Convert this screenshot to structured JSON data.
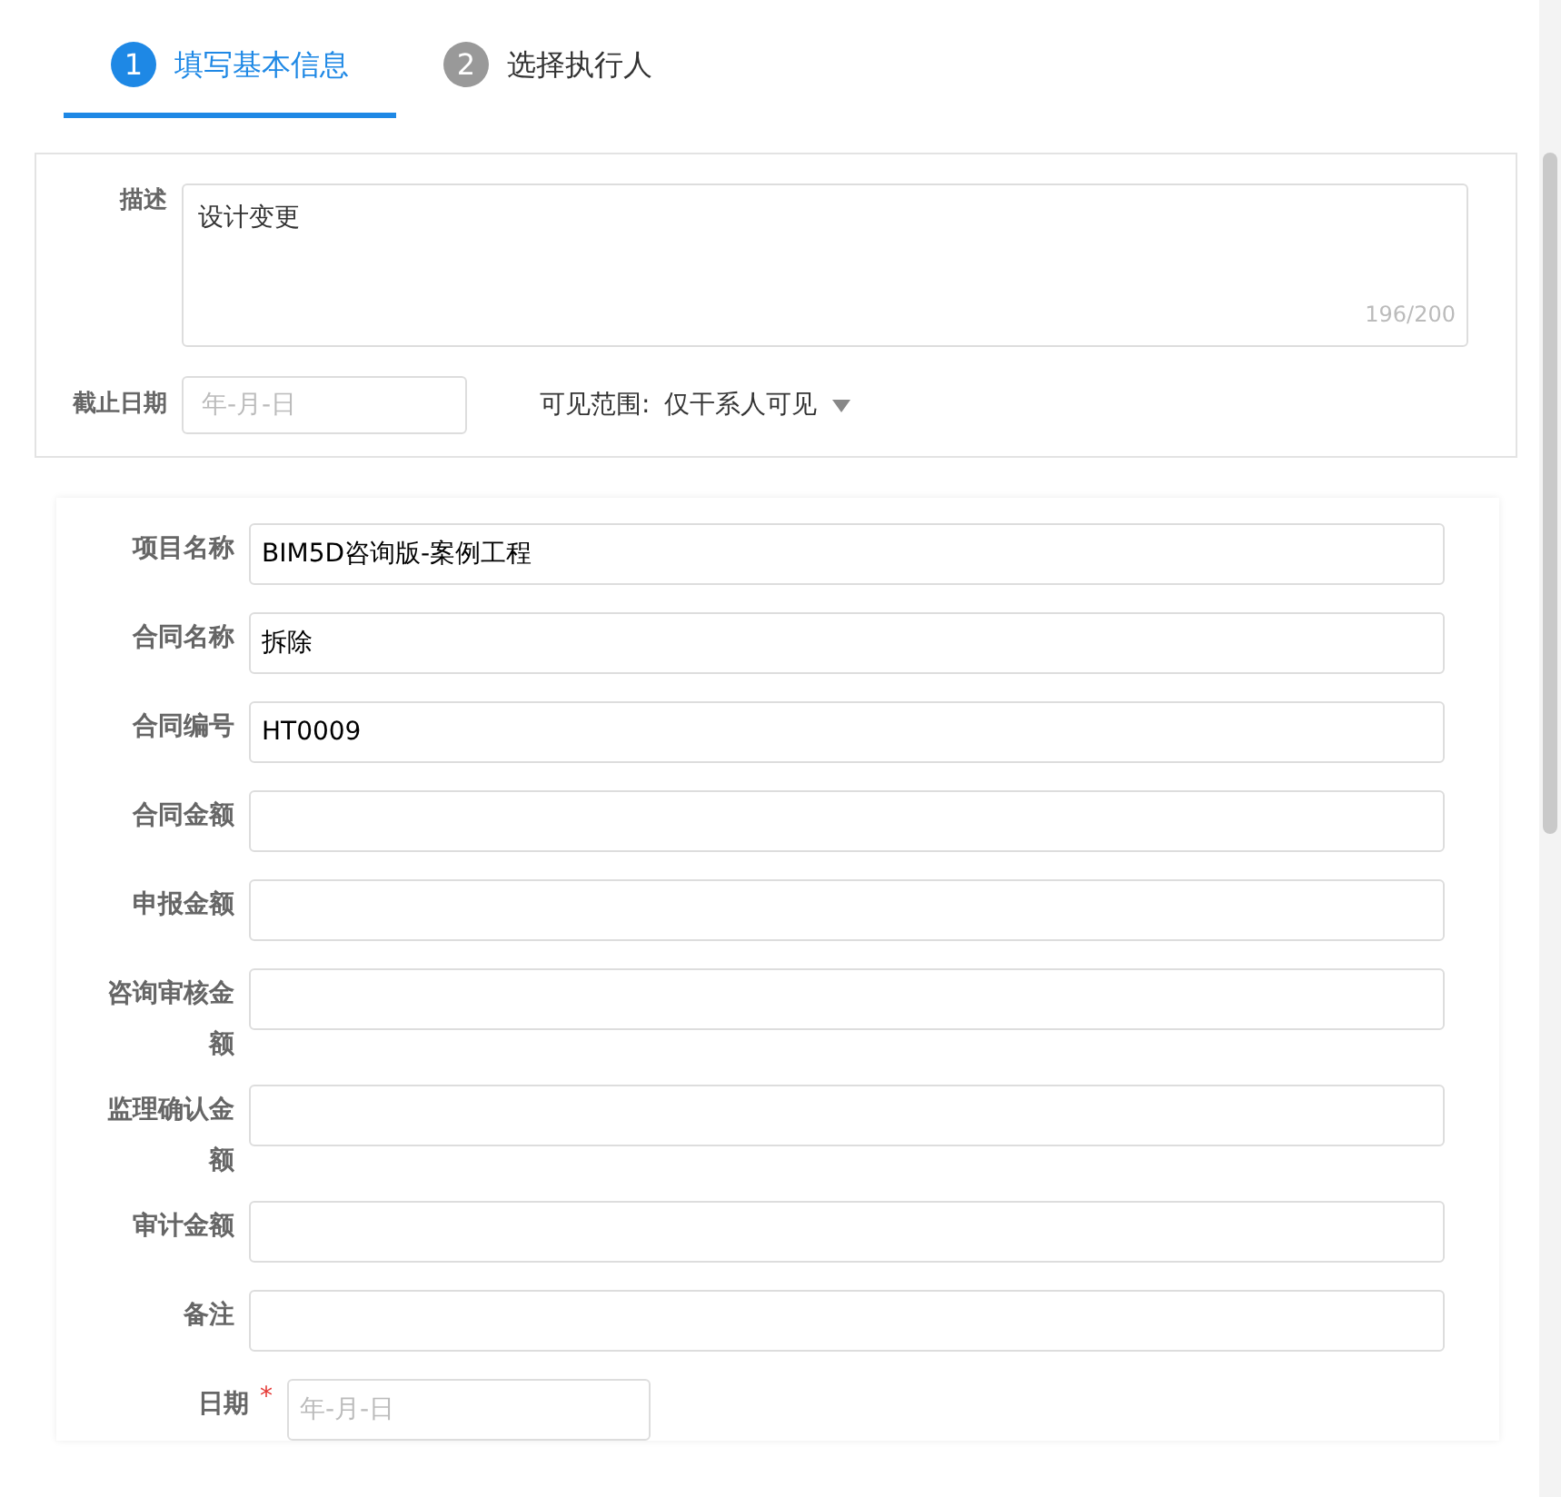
{
  "steps": [
    {
      "number": "1",
      "label": "填写基本信息",
      "selected": true
    },
    {
      "number": "2",
      "label": "选择执行人",
      "selected": false
    }
  ],
  "basic": {
    "description_label": "描述",
    "description_value": "设计变更",
    "counter": "196/200",
    "deadline_label": "截止日期",
    "deadline_placeholder": "年-月-日",
    "visibility_label": "可见范围:",
    "visibility_value": "仅干系人可见"
  },
  "fields": [
    {
      "label": "项目名称",
      "value": "BIM5D咨询版-案例工程",
      "kind": "text"
    },
    {
      "label": "合同名称",
      "value": "拆除",
      "kind": "text"
    },
    {
      "label": "合同编号",
      "value": "HT0009",
      "kind": "text"
    },
    {
      "label": "合同金额",
      "kind": "text"
    },
    {
      "label": "申报金额",
      "kind": "text"
    },
    {
      "label": "咨询审核金额",
      "kind": "text"
    },
    {
      "label": "监理确认金额",
      "kind": "text"
    },
    {
      "label": "审计金额",
      "kind": "text"
    },
    {
      "label": "备注",
      "kind": "text"
    },
    {
      "label": "日期",
      "required_mark": "*",
      "placeholder": "年-月-日",
      "kind": "date"
    }
  ]
}
